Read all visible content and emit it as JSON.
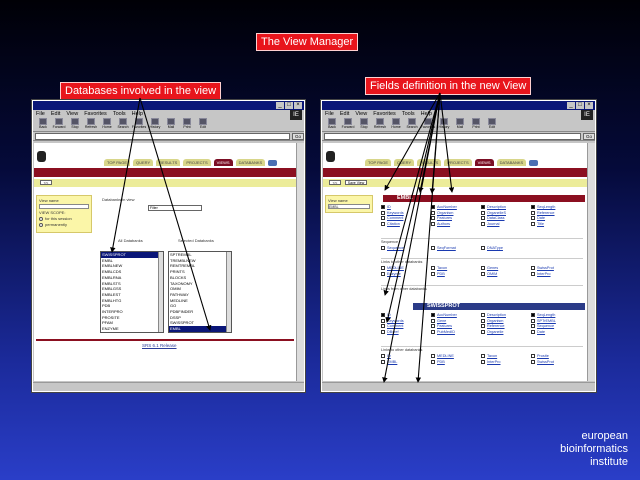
{
  "slide": {
    "title": "The View Manager",
    "callout_left": "Databases involved in the view",
    "callout_right": "Fields definition in the new View",
    "institute": [
      "european",
      "bioinformatics",
      "institute"
    ]
  },
  "browser": {
    "menu": [
      "File",
      "Edit",
      "View",
      "Favorites",
      "Tools",
      "Help"
    ],
    "logo_label": "IE",
    "go_label": "Go",
    "tools": [
      {
        "label": "Back",
        "icon": "back-arrow-icon"
      },
      {
        "label": "Forward",
        "icon": "forward-arrow-icon"
      },
      {
        "label": "Stop",
        "icon": "stop-icon"
      },
      {
        "label": "Refresh",
        "icon": "refresh-icon"
      },
      {
        "label": "Home",
        "icon": "home-icon"
      },
      {
        "label": "Search",
        "icon": "search-icon"
      },
      {
        "label": "Favorites",
        "icon": "favorites-icon"
      },
      {
        "label": "History",
        "icon": "history-icon"
      },
      {
        "label": "Mail",
        "icon": "mail-icon"
      },
      {
        "label": "Print",
        "icon": "print-icon"
      },
      {
        "label": "Edit",
        "icon": "edit-icon"
      }
    ]
  },
  "window_left": {
    "nav_tabs": [
      "TOP PAGE",
      "QUERY",
      "RESULTS",
      "PROJECTS",
      "VIEWS",
      "DATABANKS"
    ],
    "active_tab": 4,
    "subbar_button": "<<",
    "panel_rows": [
      "View name",
      "",
      "VIEW SCOPE:",
      "for this session",
      "permanently"
    ],
    "selected_label": "Databanks in view",
    "select_value": "Filter",
    "left_list_header": [
      "All",
      "Databanks"
    ],
    "right_list_header": [
      "Selected",
      "Databanks"
    ],
    "left_list": [
      "SWISSPROT",
      "EMBL",
      "EMBLNEW",
      "EMBLCDS",
      "EMBLRNA",
      "EMBLSTS",
      "EMBLGSS",
      "EMBLEST",
      "EMBLHTG",
      "PDB",
      "INTERPRO",
      "PROSITE",
      "PFAM",
      "ENZYME"
    ],
    "right_list": [
      "SPTREMBL",
      "TREMBLNEW",
      "REMTREMBL",
      "PRINTS",
      "BLOCKS",
      "TAXONOMY",
      "OMIM",
      "PATHWAY",
      "MEDLINE",
      "GO",
      "PDBFINDER",
      "DSSP",
      "SWISSPROT",
      "EMBL"
    ],
    "footer": "SRS 6.1 Release"
  },
  "window_right": {
    "nav_tabs": [
      "TOP PAGE",
      "QUERY",
      "RESULTS",
      "PROJECTS",
      "VIEWS",
      "DATABANKS"
    ],
    "active_tab": 4,
    "subbar_button": "<<",
    "subbar_button2": "Save View",
    "panel_rows": [
      "View name",
      "EMBL"
    ],
    "section1": "EMBL",
    "section1_fields": [
      {
        "label": "ID",
        "on": true
      },
      {
        "label": "AccNumber",
        "on": true
      },
      {
        "label": "Description",
        "on": true
      },
      {
        "label": "SeqLength",
        "on": true
      },
      {
        "label": "Keywords",
        "on": false
      },
      {
        "label": "Organism",
        "on": false
      },
      {
        "label": "OrganelleS",
        "on": false
      },
      {
        "label": "Reference",
        "on": false
      },
      {
        "label": "Comment",
        "on": false
      },
      {
        "label": "Features",
        "on": false
      },
      {
        "label": "DataClass",
        "on": false
      },
      {
        "label": "Date",
        "on": false
      },
      {
        "label": "Citation",
        "on": false
      },
      {
        "label": "Authors",
        "on": false
      },
      {
        "label": "Journal",
        "on": false
      },
      {
        "label": "Title",
        "on": false
      }
    ],
    "group1_label": "Sequence",
    "group1_fields": [
      {
        "label": "Sequence",
        "on": false
      },
      {
        "label": "SeqFormat",
        "on": false
      },
      {
        "label": "DNAType",
        "on": false
      }
    ],
    "group2_label": "Links to other databanks",
    "group2_fields": [
      {
        "label": "MEDLINE",
        "on": false
      },
      {
        "label": "Taxon",
        "on": false
      },
      {
        "label": "Genes",
        "on": false
      },
      {
        "label": "SwissProt",
        "on": false
      },
      {
        "label": "Enzyme",
        "on": false
      },
      {
        "label": "PDB",
        "on": false
      },
      {
        "label": "OMIM",
        "on": false
      },
      {
        "label": "InterPro",
        "on": false
      }
    ],
    "group3_label": "Links from other databanks",
    "section2": "SWISSPROT",
    "section2_fields": [
      {
        "label": "ID",
        "on": true
      },
      {
        "label": "AccNumber",
        "on": true
      },
      {
        "label": "Description",
        "on": false
      },
      {
        "label": "SeqLength",
        "on": true
      },
      {
        "label": "Keywords",
        "on": false
      },
      {
        "label": "Gene",
        "on": false
      },
      {
        "label": "Organism",
        "on": false
      },
      {
        "label": "SPTrEMBL",
        "on": false
      },
      {
        "label": "Comment",
        "on": false
      },
      {
        "label": "Features",
        "on": false
      },
      {
        "label": "Reference",
        "on": false
      },
      {
        "label": "Sequence",
        "on": false
      },
      {
        "label": "DBxref",
        "on": false
      },
      {
        "label": "PubMedID",
        "on": false
      },
      {
        "label": "Organelle",
        "on": false
      },
      {
        "label": "Date",
        "on": false
      }
    ],
    "group4_label": "Links to other databanks",
    "group4_fields": [
      {
        "label": "ID",
        "on": false
      },
      {
        "label": "MEDLINE",
        "on": false
      },
      {
        "label": "Taxon",
        "on": false
      },
      {
        "label": "Prosite",
        "on": false
      },
      {
        "label": "EMBL",
        "on": false
      },
      {
        "label": "PDB",
        "on": false
      },
      {
        "label": "InterPro",
        "on": false
      },
      {
        "label": "SwissProt",
        "on": false
      }
    ]
  }
}
